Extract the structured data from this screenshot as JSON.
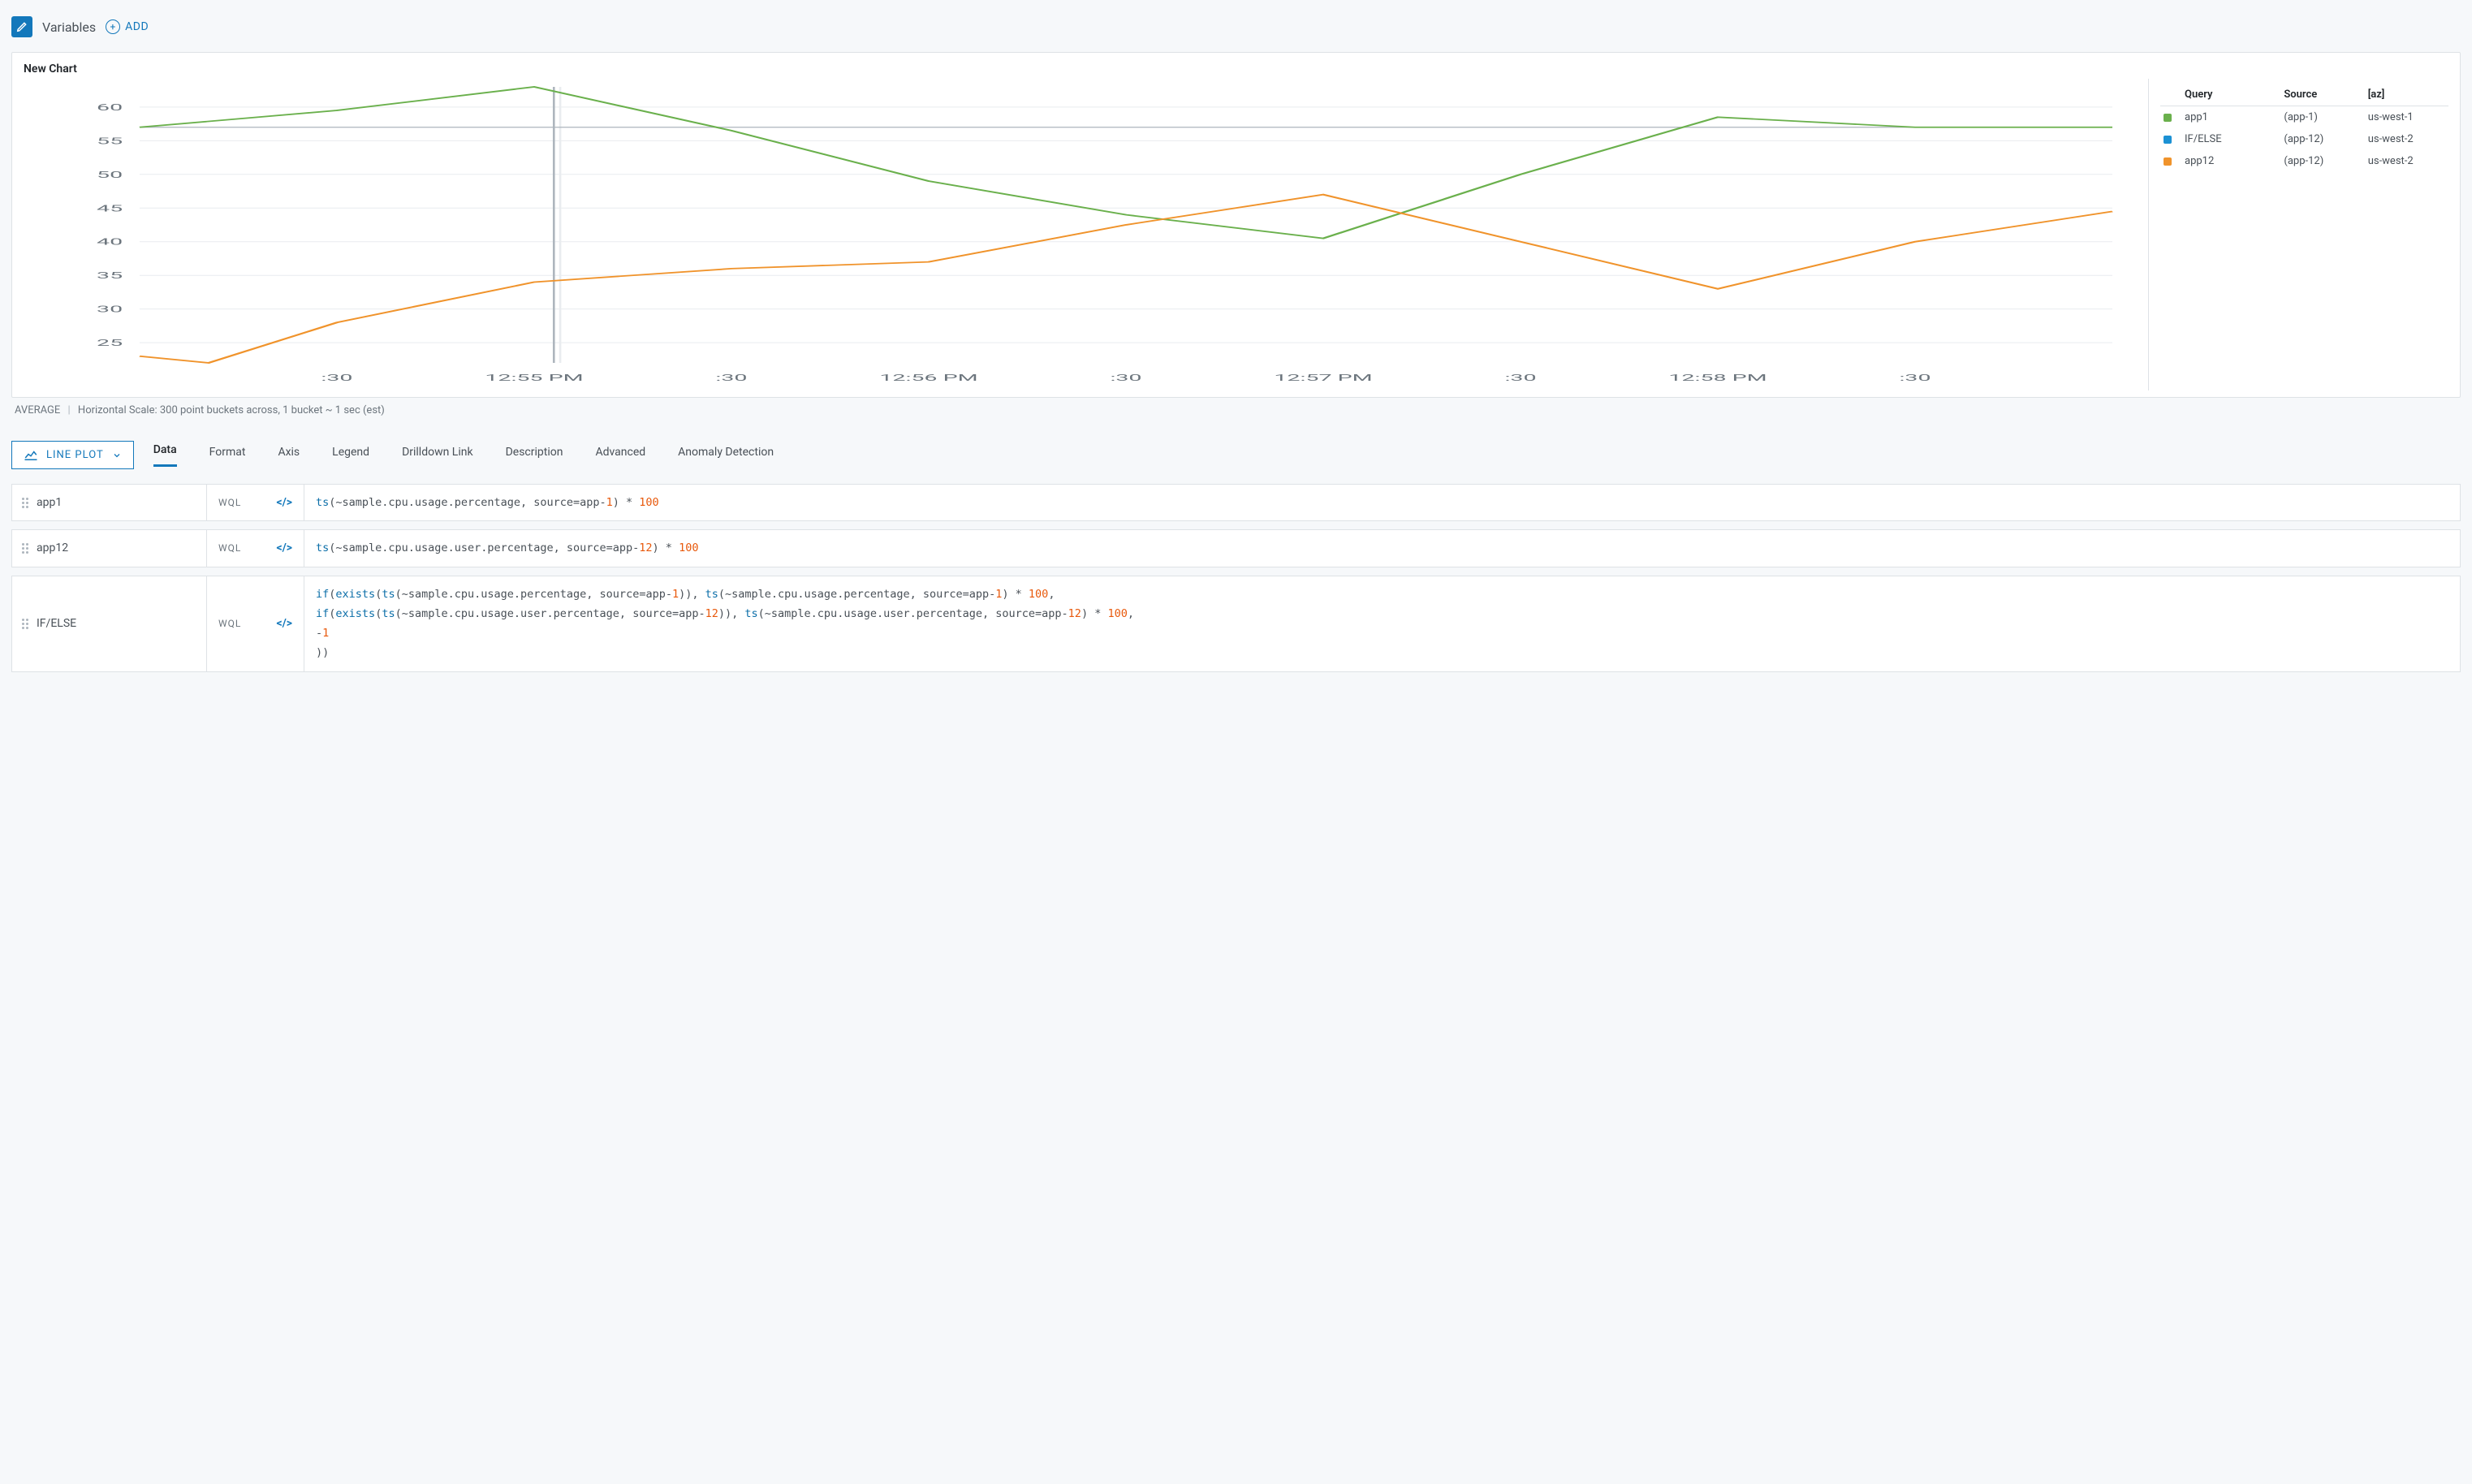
{
  "variables_bar": {
    "label": "Variables",
    "add_label": "ADD"
  },
  "chart": {
    "title": "New Chart",
    "footer_metric": "AVERAGE",
    "footer_scale": "Horizontal Scale: 300 point buckets across, 1 bucket ~ 1 sec (est)"
  },
  "plot_type_label": "LINE PLOT",
  "tabs": [
    "Data",
    "Format",
    "Axis",
    "Legend",
    "Drilldown Link",
    "Description",
    "Advanced",
    "Anomaly Detection"
  ],
  "active_tab": 0,
  "legend": {
    "headers": [
      "Query",
      "Source",
      "[az]"
    ],
    "rows": [
      {
        "color": "#6ab04c",
        "query": "app1",
        "source": "(app-1)",
        "az": "us-west-1"
      },
      {
        "color": "#1c91d4",
        "query": "IF/ELSE",
        "source": "(app-12)",
        "az": "us-west-2"
      },
      {
        "color": "#f0932b",
        "query": "app12",
        "source": "(app-12)",
        "az": "us-west-2"
      }
    ]
  },
  "queries": [
    {
      "name": "app1",
      "lang": "WQL",
      "expr_tokens": [
        {
          "t": "fn",
          "v": "ts"
        },
        {
          "t": "plain",
          "v": "(~sample.cpu.usage.percentage, source=app-"
        },
        {
          "t": "num",
          "v": "1"
        },
        {
          "t": "plain",
          "v": ") * "
        },
        {
          "t": "num",
          "v": "100"
        }
      ]
    },
    {
      "name": "app12",
      "lang": "WQL",
      "expr_tokens": [
        {
          "t": "fn",
          "v": "ts"
        },
        {
          "t": "plain",
          "v": "(~sample.cpu.usage.user.percentage, source=app-"
        },
        {
          "t": "num",
          "v": "12"
        },
        {
          "t": "plain",
          "v": ") * "
        },
        {
          "t": "num",
          "v": "100"
        }
      ]
    },
    {
      "name": "IF/ELSE",
      "lang": "WQL",
      "expr_tokens": [
        {
          "t": "fn",
          "v": "if"
        },
        {
          "t": "plain",
          "v": "("
        },
        {
          "t": "fn",
          "v": "exists"
        },
        {
          "t": "plain",
          "v": "("
        },
        {
          "t": "fn",
          "v": "ts"
        },
        {
          "t": "plain",
          "v": "(~sample.cpu.usage.percentage, source=app-"
        },
        {
          "t": "num",
          "v": "1"
        },
        {
          "t": "plain",
          "v": ")), "
        },
        {
          "t": "fn",
          "v": "ts"
        },
        {
          "t": "plain",
          "v": "(~sample.cpu.usage.percentage, source=app-"
        },
        {
          "t": "num",
          "v": "1"
        },
        {
          "t": "plain",
          "v": ") * "
        },
        {
          "t": "num",
          "v": "100"
        },
        {
          "t": "plain",
          "v": ",\n"
        },
        {
          "t": "fn",
          "v": "if"
        },
        {
          "t": "plain",
          "v": "("
        },
        {
          "t": "fn",
          "v": "exists"
        },
        {
          "t": "plain",
          "v": "("
        },
        {
          "t": "fn",
          "v": "ts"
        },
        {
          "t": "plain",
          "v": "(~sample.cpu.usage.user.percentage, source=app-"
        },
        {
          "t": "num",
          "v": "12"
        },
        {
          "t": "plain",
          "v": ")), "
        },
        {
          "t": "fn",
          "v": "ts"
        },
        {
          "t": "plain",
          "v": "(~sample.cpu.usage.user.percentage, source=app-"
        },
        {
          "t": "num",
          "v": "12"
        },
        {
          "t": "plain",
          "v": ") * "
        },
        {
          "t": "num",
          "v": "100"
        },
        {
          "t": "plain",
          "v": ",\n-"
        },
        {
          "t": "num",
          "v": "1"
        },
        {
          "t": "plain",
          "v": "\n))"
        }
      ]
    }
  ],
  "chart_data": {
    "type": "line",
    "ylabel": "",
    "xlabel": "",
    "ylim": [
      22,
      63
    ],
    "y_ticks": [
      25,
      30,
      35,
      40,
      45,
      50,
      55,
      60
    ],
    "x_labels": [
      ":30",
      "12:55 PM",
      ":30",
      "12:56 PM",
      ":30",
      "12:57 PM",
      ":30",
      "12:58 PM",
      ":30"
    ],
    "x": [
      0,
      1,
      2,
      3,
      4,
      5,
      6,
      7,
      8,
      9,
      10
    ],
    "cursor_x": 2.1,
    "series": [
      {
        "name": "app1",
        "color": "#6ab04c",
        "values": [
          57,
          59.5,
          63,
          56.5,
          49,
          44,
          40.5,
          50,
          58.5,
          57,
          57
        ]
      },
      {
        "name": "app12",
        "color": "#f0932b",
        "values": [
          23,
          22,
          28,
          34,
          36,
          37,
          42.5,
          47,
          40,
          33,
          40,
          44.5
        ],
        "x": [
          0,
          0.35,
          1,
          2,
          3,
          4,
          5,
          6,
          7,
          8,
          9,
          10
        ]
      }
    ],
    "hline": 57
  }
}
